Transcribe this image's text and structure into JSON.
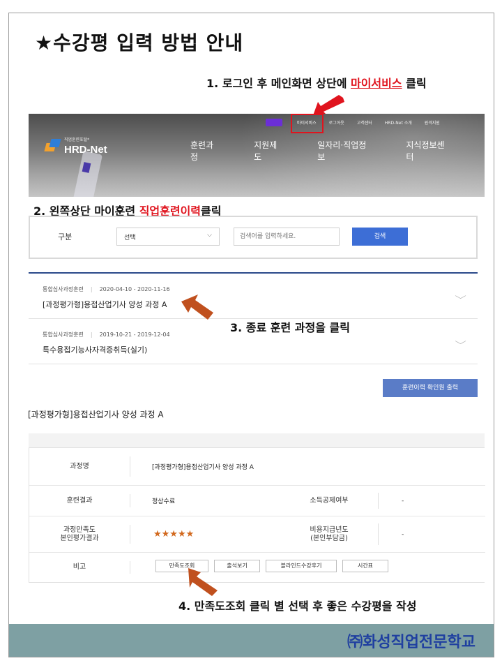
{
  "title": "★수강평 입력 방법 안내",
  "steps": {
    "s1_pre": "1. 로그인 후   메인화면 상단에 ",
    "s1_hl": "마이서비스",
    "s1_post": " 클릭",
    "s2_pre": "2. 왼쪽상단 마이훈련 ",
    "s2_hl": "직업훈련이력",
    "s2_post": "클릭",
    "s3": "3. 종료 훈련 과정을 클릭",
    "s4": "4. 만족도조회 클릭  별  선택 후 좋은 수강평을 작성"
  },
  "banner": {
    "util_nav": [
      "마이서비스",
      "로그아웃",
      "고객센터",
      "HRD-Net 소개",
      "원격지원"
    ],
    "logo_sub": "직업훈련포털*",
    "logo_main": "HRD-Net",
    "main_nav": [
      "훈련과정",
      "지원제도",
      "일자리·직업정보",
      "지식정보센터"
    ]
  },
  "search": {
    "label": "구분",
    "select_value": "선택",
    "input_placeholder": "검색어를 입력하세요.",
    "button": "검색"
  },
  "history": [
    {
      "category": "통합심사과정훈련",
      "period": "2020-04-10 - 2020-11-16",
      "title": "[과정평가형]용접산업기사 양성 과정 A"
    },
    {
      "category": "통합심사과정훈련",
      "period": "2019-10-21 - 2019-12-04",
      "title": "특수용접기능사자격증취득(실기)"
    }
  ],
  "print_button": "훈련이력 확인원 출력",
  "course_heading": "[과정평가형]용접산업기사 양성 과정 A",
  "detail": {
    "course_name_label": "과정명",
    "course_name": "[과정평가형]용접산업기사 양성 과정 A",
    "result_label": "훈련결과",
    "result": "정상수료",
    "tax_label": "소득공제여부",
    "tax_value": "-",
    "satisfaction_label_1": "과정만족도",
    "satisfaction_label_2": "본인평가결과",
    "rating": 5,
    "stars": "★★★★★",
    "cost_label_1": "비용지급년도",
    "cost_label_2": "(본인부담금)",
    "cost_value": "-",
    "note_label": "비고",
    "buttons": [
      "만족도조회",
      "출석보기",
      "블라인드수강후기",
      "시간표"
    ]
  },
  "footer": "㈜화성직업전문학교",
  "colors": {
    "highlight": "#e0141e",
    "arrow": "#c0501e",
    "primary_button": "#3d6ed6",
    "footer_band": "#7ea0a3",
    "footer_text": "#1f3fa0"
  }
}
